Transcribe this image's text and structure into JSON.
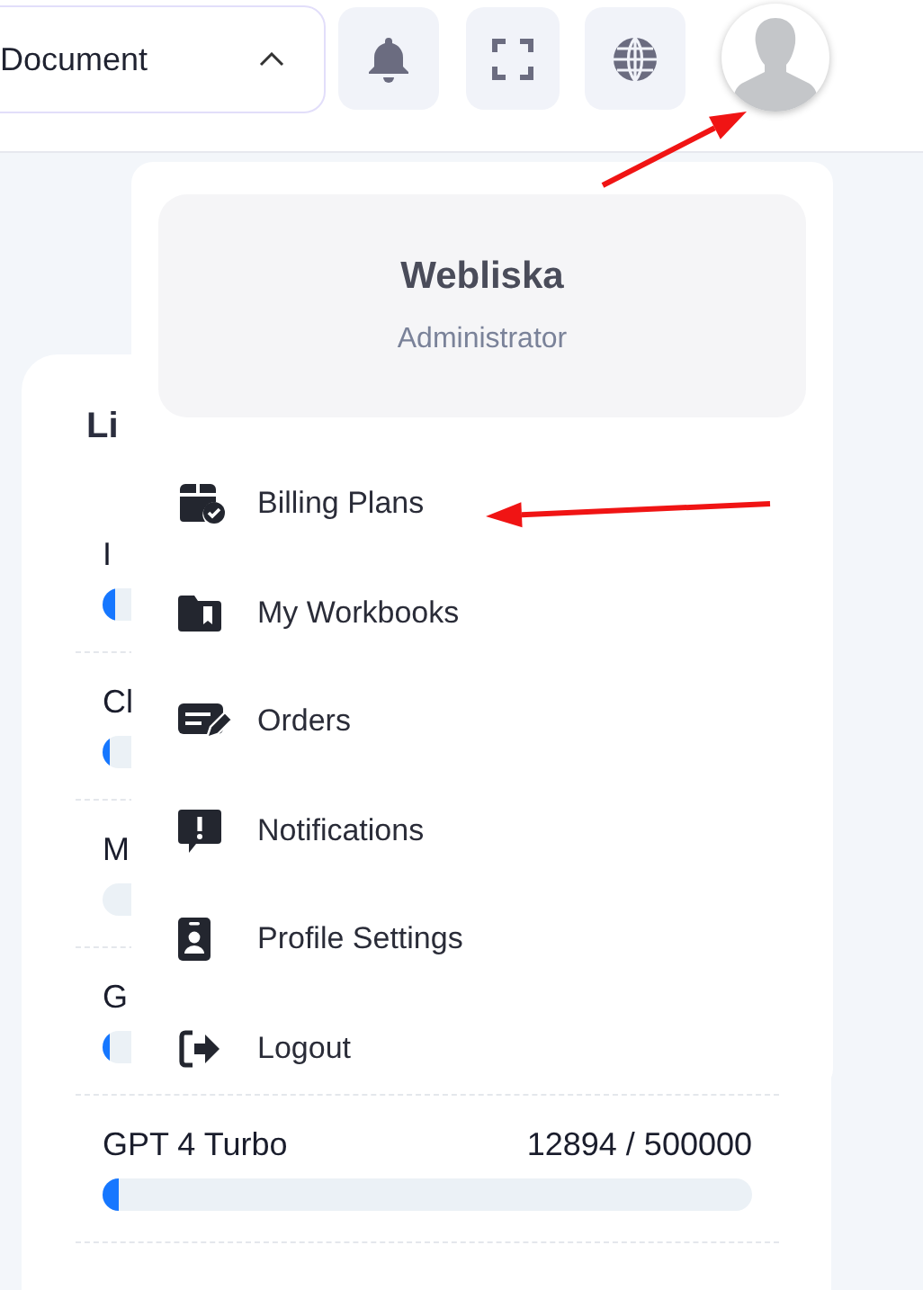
{
  "topbar": {
    "document_select": {
      "value": "Document",
      "expanded": true
    }
  },
  "usage_card": {
    "title": "Li",
    "rows": [
      {
        "label": "I",
        "level": 0.02
      },
      {
        "label": "Cl",
        "level": 0.01
      },
      {
        "label": "M",
        "level": 0
      },
      {
        "label": "G",
        "level": 0.01
      },
      {
        "label": "GPT 4 Turbo",
        "reading": "12894 / 500000",
        "level": 0.026
      }
    ]
  },
  "user_menu": {
    "name": "Webliska",
    "role": "Administrator",
    "items": [
      {
        "label": "Billing Plans",
        "kind": "billing"
      },
      {
        "label": "My Workbooks",
        "kind": "workbooks"
      },
      {
        "label": "Orders",
        "kind": "orders"
      },
      {
        "label": "Notifications",
        "kind": "notifications"
      },
      {
        "label": "Profile Settings",
        "kind": "profile"
      },
      {
        "label": "Logout",
        "kind": "logout"
      }
    ]
  },
  "annotations": [
    {
      "kind": "arrow"
    },
    {
      "kind": "arrow"
    }
  ]
}
